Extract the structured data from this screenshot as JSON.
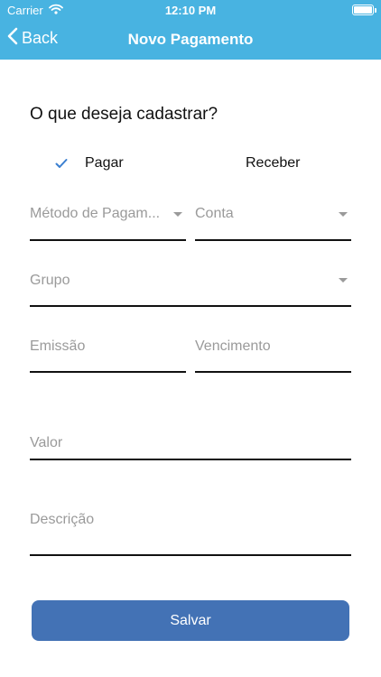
{
  "status_bar": {
    "carrier": "Carrier",
    "time": "12:10 PM"
  },
  "nav": {
    "back_label": "Back",
    "title": "Novo Pagamento"
  },
  "form": {
    "question": "O que deseja cadastrar?",
    "options": [
      {
        "label": "Pagar",
        "selected": true
      },
      {
        "label": "Receber",
        "selected": false
      }
    ],
    "fields": {
      "metodo": {
        "placeholder": "Método de Pagam..."
      },
      "conta": {
        "placeholder": "Conta"
      },
      "grupo": {
        "placeholder": "Grupo"
      },
      "emissao": {
        "placeholder": "Emissão"
      },
      "vencimento": {
        "placeholder": "Vencimento"
      },
      "valor": {
        "placeholder": "Valor"
      },
      "descricao": {
        "placeholder": "Descrição"
      }
    },
    "save_label": "Salvar"
  },
  "colors": {
    "header": "#48b3e1",
    "button": "#4372b5",
    "check": "#3a7fd0",
    "placeholder": "#9a9a9a"
  }
}
